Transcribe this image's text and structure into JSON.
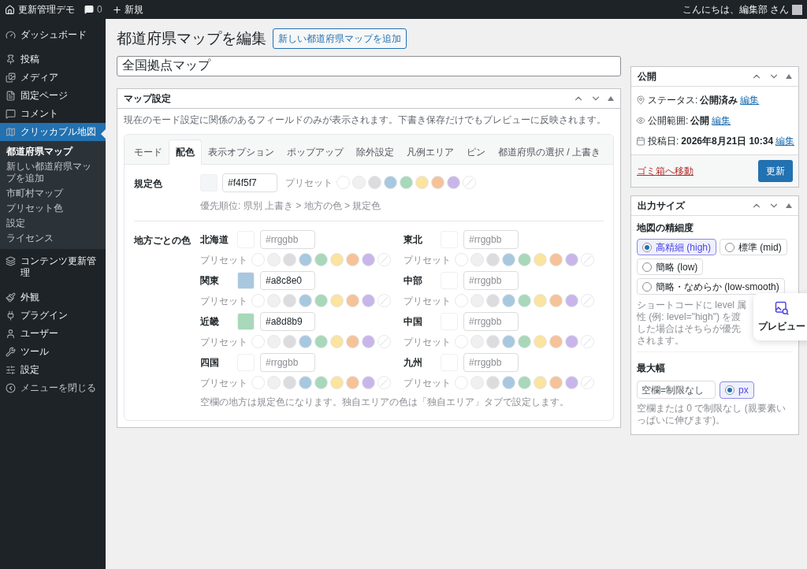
{
  "admin_bar": {
    "site_name": "更新管理デモ",
    "comments_count": "0",
    "new_label": "新規",
    "greeting": "こんにちは、編集部 さん"
  },
  "sidebar": {
    "items": [
      {
        "label": "ダッシュボード",
        "selected": false
      },
      {
        "label": "投稿",
        "selected": false
      },
      {
        "label": "メディア",
        "selected": false
      },
      {
        "label": "固定ページ",
        "selected": false
      },
      {
        "label": "コメント",
        "selected": false
      },
      {
        "label": "クリッカブル地図",
        "selected": true,
        "children": [
          {
            "label": "都道府県マップ",
            "selected": true
          },
          {
            "label": "新しい都道府県マップを追加",
            "selected": false
          },
          {
            "label": "市町村マップ",
            "selected": false
          },
          {
            "label": "プリセット色",
            "selected": false
          },
          {
            "label": "設定",
            "selected": false
          },
          {
            "label": "ライセンス",
            "selected": false
          }
        ]
      },
      {
        "label": "コンテンツ更新管理",
        "selected": false
      },
      {
        "label": "外観",
        "selected": false
      },
      {
        "label": "プラグイン",
        "selected": false
      },
      {
        "label": "ユーザー",
        "selected": false
      },
      {
        "label": "ツール",
        "selected": false
      },
      {
        "label": "設定",
        "selected": false
      },
      {
        "label": "メニューを閉じる",
        "selected": false
      }
    ]
  },
  "page": {
    "title": "都道府県マップを編集",
    "add_button": "新しい都道府県マップを追加",
    "post_title": "全国拠点マップ"
  },
  "map_settings": {
    "title": "マップ設定",
    "description": "現在のモード設定に関係のあるフィールドのみが表示されます。下書き保存だけでもプレビューに反映されます。",
    "tabs": [
      {
        "label": "モード",
        "selected": false
      },
      {
        "label": "配色",
        "selected": true
      },
      {
        "label": "表示オプション",
        "selected": false
      },
      {
        "label": "ポップアップ",
        "selected": false
      },
      {
        "label": "除外設定",
        "selected": false
      },
      {
        "label": "凡例エリア",
        "selected": false
      },
      {
        "label": "ピン",
        "selected": false
      },
      {
        "label": "都道府県の選択 / 上書き",
        "selected": false
      }
    ],
    "presets": [
      {
        "kind": "color",
        "color": "#ffffff"
      },
      {
        "kind": "color",
        "color": "#f0f0f1"
      },
      {
        "kind": "color",
        "color": "#dcdcde"
      },
      {
        "kind": "color",
        "color": "#a8c8e0"
      },
      {
        "kind": "color",
        "color": "#a8d8b9"
      },
      {
        "kind": "color",
        "color": "#fbe3a0"
      },
      {
        "kind": "color",
        "color": "#f5c29a"
      },
      {
        "kind": "color",
        "color": "#c8b6ea"
      },
      {
        "kind": "none"
      }
    ],
    "default_color": {
      "label": "規定色",
      "value": "#f4f5f7",
      "color": "#f4f5f7",
      "preset_label": "プリセット",
      "hint": "優先順位: 県別 上書き > 地方の色 > 規定色"
    },
    "regions_label": "地方ごとの色",
    "regions": [
      {
        "name": "北海道",
        "placeholder": "#rrggbb",
        "preset_label": "プリセット"
      },
      {
        "name": "東北",
        "placeholder": "#rrggbb",
        "preset_label": "プリセット"
      },
      {
        "name": "関東",
        "value": "#a8c8e0",
        "color": "#a8c8e0",
        "preset_label": "プリセット"
      },
      {
        "name": "中部",
        "placeholder": "#rrggbb",
        "preset_label": "プリセット"
      },
      {
        "name": "近畿",
        "value": "#a8d8b9",
        "color": "#a8d8b9",
        "preset_label": "プリセット"
      },
      {
        "name": "中国",
        "placeholder": "#rrggbb",
        "preset_label": "プリセット"
      },
      {
        "name": "四国",
        "placeholder": "#rrggbb",
        "preset_label": "プリセット"
      },
      {
        "name": "九州",
        "placeholder": "#rrggbb",
        "preset_label": "プリセット"
      }
    ],
    "note": "空欄の地方は規定色になります。独自エリアの色は「独自エリア」タブで設定します。"
  },
  "publish": {
    "title": "公開",
    "rows": [
      {
        "label": "ステータス:",
        "value": "公開済み",
        "link": "編集"
      },
      {
        "label": "公開範囲:",
        "value": "公開",
        "link": "編集"
      },
      {
        "label": "投稿日:",
        "value": "2026年8月21日 10:34",
        "link": "編集"
      }
    ],
    "trash": "ゴミ箱へ移動",
    "update": "更新"
  },
  "output_size": {
    "title": "出力サイズ",
    "detail_label": "地図の精細度",
    "detail_options": [
      {
        "label": "高精細 (high)",
        "selected": true
      },
      {
        "label": "標準 (mid)",
        "selected": false
      },
      {
        "label": "簡略 (low)",
        "selected": false
      },
      {
        "label": "簡略・なめらか (low-smooth)",
        "selected": false
      }
    ],
    "detail_note": "ショートコードに level 属性 (例: level=\"high\") を渡した場合はそちらが優先されます。",
    "max_width_label": "最大幅",
    "max_width_placeholder": "空欄=制限なし",
    "unit_options": [
      {
        "label": "px",
        "selected": true
      }
    ],
    "max_width_note": "空欄または 0 で制限なし (親要素いっぱいに伸びます)。"
  },
  "preview_button": "プレビュー"
}
